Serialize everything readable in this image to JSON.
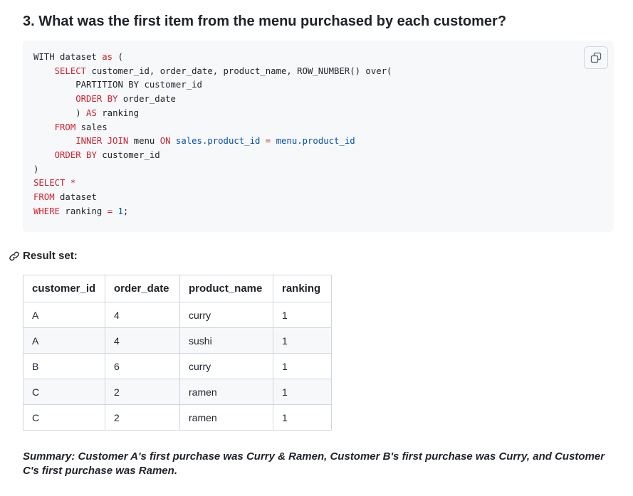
{
  "heading": "3. What was the first item from the menu purchased by each customer?",
  "code": {
    "lines": [
      [
        {
          "t": "WITH dataset "
        },
        {
          "t": "as",
          "k": "kw"
        },
        {
          "t": " ("
        }
      ],
      [
        {
          "t": "    "
        },
        {
          "t": "SELECT",
          "k": "kw"
        },
        {
          "t": " customer_id, order_date, product_name, ROW_NUMBER() over("
        }
      ],
      [
        {
          "t": "        PARTITION BY customer_id"
        }
      ],
      [
        {
          "t": "        "
        },
        {
          "t": "ORDER BY",
          "k": "kw"
        },
        {
          "t": " order_date"
        }
      ],
      [
        {
          "t": "        ) "
        },
        {
          "t": "AS",
          "k": "kw"
        },
        {
          "t": " ranking"
        }
      ],
      [
        {
          "t": "    "
        },
        {
          "t": "FROM",
          "k": "kw"
        },
        {
          "t": " sales"
        }
      ],
      [
        {
          "t": "        "
        },
        {
          "t": "INNER JOIN",
          "k": "kw"
        },
        {
          "t": " menu "
        },
        {
          "t": "ON",
          "k": "kw"
        },
        {
          "t": " "
        },
        {
          "t": "sales.product_id",
          "k": "ent"
        },
        {
          "t": " "
        },
        {
          "t": "=",
          "k": "kw"
        },
        {
          "t": " "
        },
        {
          "t": "menu.product_id",
          "k": "ent"
        }
      ],
      [
        {
          "t": "    "
        },
        {
          "t": "ORDER BY",
          "k": "kw"
        },
        {
          "t": " customer_id"
        }
      ],
      [
        {
          "t": ")"
        }
      ],
      [
        {
          "t": "SELECT",
          "k": "kw"
        },
        {
          "t": " "
        },
        {
          "t": "*",
          "k": "kw"
        }
      ],
      [
        {
          "t": "FROM",
          "k": "kw"
        },
        {
          "t": " dataset"
        }
      ],
      [
        {
          "t": "WHERE",
          "k": "kw"
        },
        {
          "t": " ranking "
        },
        {
          "t": "=",
          "k": "kw"
        },
        {
          "t": " "
        },
        {
          "t": "1",
          "k": "ent"
        },
        {
          "t": ";"
        }
      ]
    ],
    "copy_icon": "copy-icon"
  },
  "result_heading": "Result set:",
  "result_icon": "link-icon",
  "table": {
    "columns": [
      "customer_id",
      "order_date",
      "product_name",
      "ranking"
    ],
    "rows": [
      [
        "A",
        "4",
        "curry",
        "1"
      ],
      [
        "A",
        "4",
        "sushi",
        "1"
      ],
      [
        "B",
        "6",
        "curry",
        "1"
      ],
      [
        "C",
        "2",
        "ramen",
        "1"
      ],
      [
        "C",
        "2",
        "ramen",
        "1"
      ]
    ]
  },
  "summary": "Summary: Customer A's first purchase was Curry & Ramen, Customer B's first purchase was Curry, and Customer C's first purchase was Ramen.",
  "colors": {
    "keyword": "#cf222e",
    "entity": "#0550ae",
    "code_bg": "#f6f8fa",
    "border": "#d0d7de"
  }
}
